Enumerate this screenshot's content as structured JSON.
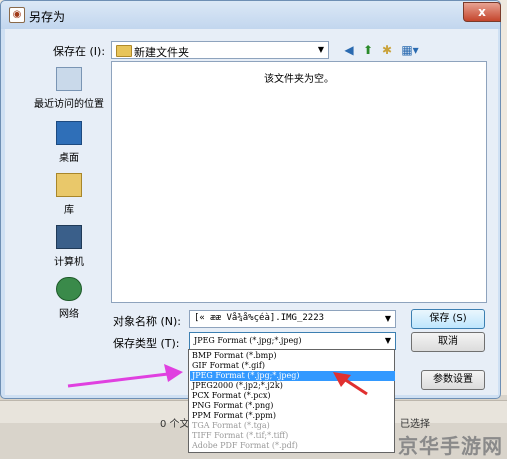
{
  "dialog": {
    "title": "另存为",
    "close_glyph": "x",
    "save_in_label": "保存在 (I):",
    "save_in_value": "新建文件夹",
    "empty_message": "该文件夹为空。",
    "filename_label": "对象名称 (N):",
    "filename_value": "[« ææ Vå¾å%çéà].IMG_2223",
    "filetype_label": "保存类型 (T):",
    "filetype_value": "JPEG Format (*.jpg;*.jpeg)",
    "save_button": "保存 (S)",
    "cancel_button": "取消",
    "options_button": "参数设置"
  },
  "places": [
    {
      "label": "最近访问的位置",
      "icon": "recent-places-icon"
    },
    {
      "label": "桌面",
      "icon": "desktop-icon"
    },
    {
      "label": "库",
      "icon": "libraries-icon"
    },
    {
      "label": "计算机",
      "icon": "computer-icon"
    },
    {
      "label": "网络",
      "icon": "network-icon"
    }
  ],
  "filetype_options": [
    {
      "label": "BMP Format (*.bmp)",
      "state": "normal"
    },
    {
      "label": "GIF Format (*.gif)",
      "state": "normal"
    },
    {
      "label": "JPEG Format (*.jpg;*.jpeg)",
      "state": "selected"
    },
    {
      "label": "JPEG2000 (*.jp2;*.j2k)",
      "state": "normal"
    },
    {
      "label": "PCX Format (*.pcx)",
      "state": "normal"
    },
    {
      "label": "PNG Format (*.png)",
      "state": "normal"
    },
    {
      "label": "PPM Format (*.ppm)",
      "state": "normal"
    },
    {
      "label": "TGA Format (*.tga)",
      "state": "dim"
    },
    {
      "label": "TIFF Format (*.tif;*.tiff)",
      "state": "dim"
    },
    {
      "label": "Adobe PDF Format (*.pdf)",
      "state": "dim"
    }
  ],
  "background": {
    "status_left": "0个文件",
    "status_right": "已选择",
    "partial_text": "0 个文件",
    "watermark": "京华手游网"
  },
  "colors": {
    "selection": "#3399ff",
    "arrow_magenta": "#e040e0",
    "arrow_red": "#e03030"
  }
}
